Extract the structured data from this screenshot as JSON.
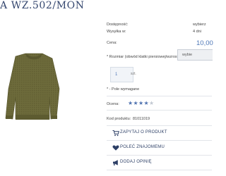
{
  "product": {
    "title": "A WZ.502/MON",
    "rows": {
      "availability_label": "Dostępność:",
      "availability_value": "wybierz",
      "shipping_label": "Wysyłka w:",
      "shipping_value": "4 dni",
      "price_label": "Cena:",
      "price_value": "10,00"
    },
    "size": {
      "label": "* Rozmiar (obwód klatki piersiowej/wzrost):",
      "selected": "wybie"
    },
    "quantity": {
      "value": "1",
      "unit": "szt."
    },
    "required_note": "* - Pole wymagane",
    "rating": {
      "label": "Ocena:",
      "stars": 4,
      "max": 5
    },
    "product_code": {
      "label": "Kod produktu:",
      "value": "81011019"
    },
    "actions": [
      {
        "label": "Zapytaj o produkt",
        "icon": "cart-icon"
      },
      {
        "label": "Poleć znajomemu",
        "icon": "heart-icon"
      },
      {
        "label": "Dodaj opinię",
        "icon": "megaphone-icon"
      }
    ]
  },
  "colors": {
    "accent": "#4f78b7",
    "title": "#35476f",
    "sweater": "#6d6b3b",
    "star_on": "#4f72b0",
    "star_off": "#c2c8d2"
  }
}
